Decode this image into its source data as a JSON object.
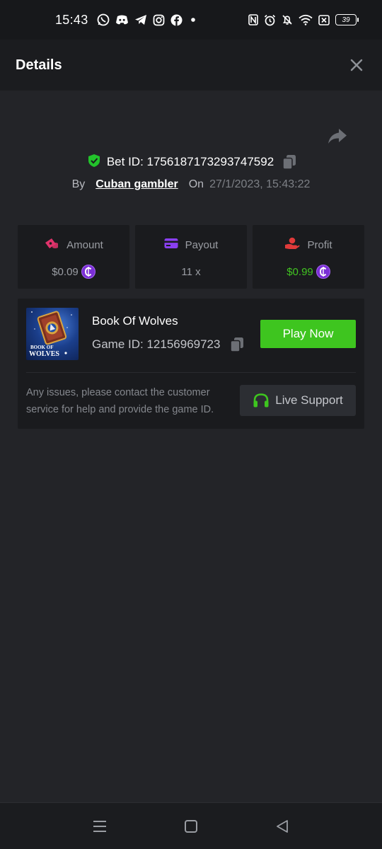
{
  "status_bar": {
    "time": "15:43",
    "battery": "39",
    "left_icons": [
      "whatsapp-icon",
      "discord-icon",
      "telegram-icon",
      "instagram-icon",
      "facebook-icon",
      "dot-icon"
    ],
    "right_icons": [
      "nfc-icon",
      "alarm-icon",
      "bell-off-icon",
      "wifi-icon",
      "sim-off-icon",
      "battery-icon"
    ]
  },
  "header": {
    "title": "Details"
  },
  "bet": {
    "label": "Bet ID: 1756187173293747592",
    "by_label": "By",
    "username": "Cuban gambler",
    "on_label": "On",
    "date": "27/1/2023, 15:43:22"
  },
  "stats": {
    "amount": {
      "label": "Amount",
      "value": "$0.09"
    },
    "payout": {
      "label": "Payout",
      "value": "11 x"
    },
    "profit": {
      "label": "Profit",
      "value": "$0.99"
    }
  },
  "game": {
    "name": "Book Of Wolves",
    "id_label": "Game ID: 12156969723",
    "thumb_text": "BOOK OF WOLVES",
    "play_label": "Play Now",
    "issue_text": "Any issues, please contact the customer service for help and provide the game ID.",
    "support_label": "Live Support"
  },
  "colors": {
    "background": "#232428",
    "card": "#1a1b1e",
    "accent_green": "#3ec51f",
    "profit_green": "#41c421",
    "coin_purple": "#7b2fd6",
    "amount_pink": "#e0336b",
    "payout_purple": "#8a3ff0",
    "profit_red": "#e03a3a"
  }
}
